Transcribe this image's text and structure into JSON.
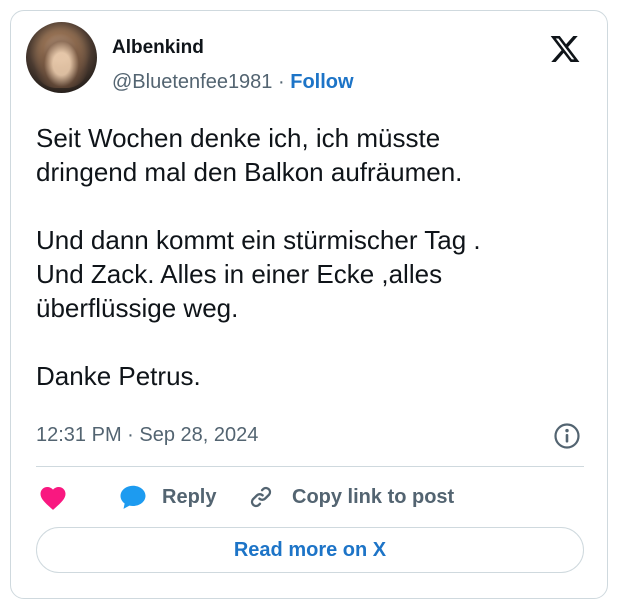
{
  "author": {
    "name": "Albenkind",
    "handle": "@Bluetenfee1981",
    "separator": "·",
    "follow_label": "Follow"
  },
  "tweet": {
    "lines": [
      "Seit Wochen denke ich, ich müsste",
      "dringend mal den Balkon aufräumen.",
      "",
      "Und dann kommt ein stürmischer Tag .",
      "Und Zack. Alles in einer Ecke ,alles",
      "überflüssige weg.",
      "",
      "Danke Petrus."
    ],
    "timestamp": "12:31 PM · Sep 28, 2024"
  },
  "actions": {
    "reply_label": "Reply",
    "copy_label": "Copy link to post"
  },
  "read_more_label": "Read more on X",
  "icons": {
    "like": "heart-icon",
    "reply": "speech-bubble-icon",
    "copy": "link-icon",
    "info": "info-icon",
    "logo": "x-logo-icon"
  },
  "colors": {
    "heart": "#f91880",
    "reply": "#1d9bf0",
    "link_blue": "#1d74c7",
    "muted": "#536471",
    "border": "#cfd9de"
  }
}
